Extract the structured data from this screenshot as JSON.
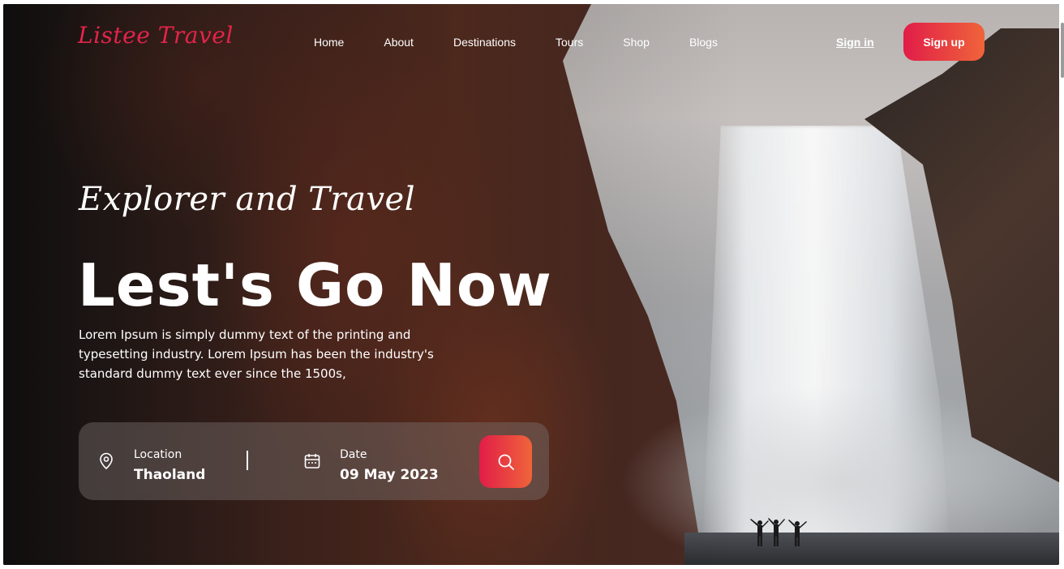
{
  "brand": {
    "logo_text": "Listee Travel",
    "accent": "#e11d48"
  },
  "nav": {
    "items": [
      {
        "label": "Home"
      },
      {
        "label": "About"
      },
      {
        "label": "Destinations"
      },
      {
        "label": "Tours"
      },
      {
        "label": "Shop"
      },
      {
        "label": "Blogs"
      }
    ],
    "signin_label": "Sign in",
    "signup_label": "Sign up"
  },
  "hero": {
    "tagline": "Explorer and Travel",
    "headline": "Lest's Go Now",
    "description": "Lorem Ipsum is simply dummy text of the printing and typesetting industry. Lorem Ipsum has been the industry's standard dummy text ever since the 1500s,"
  },
  "search": {
    "location_label": "Location",
    "location_value": "Thaoland",
    "date_label": "Date",
    "date_value": "09 May 2023",
    "location_icon": "map-pin-icon",
    "date_icon": "calendar-icon",
    "button_icon": "search-icon"
  }
}
